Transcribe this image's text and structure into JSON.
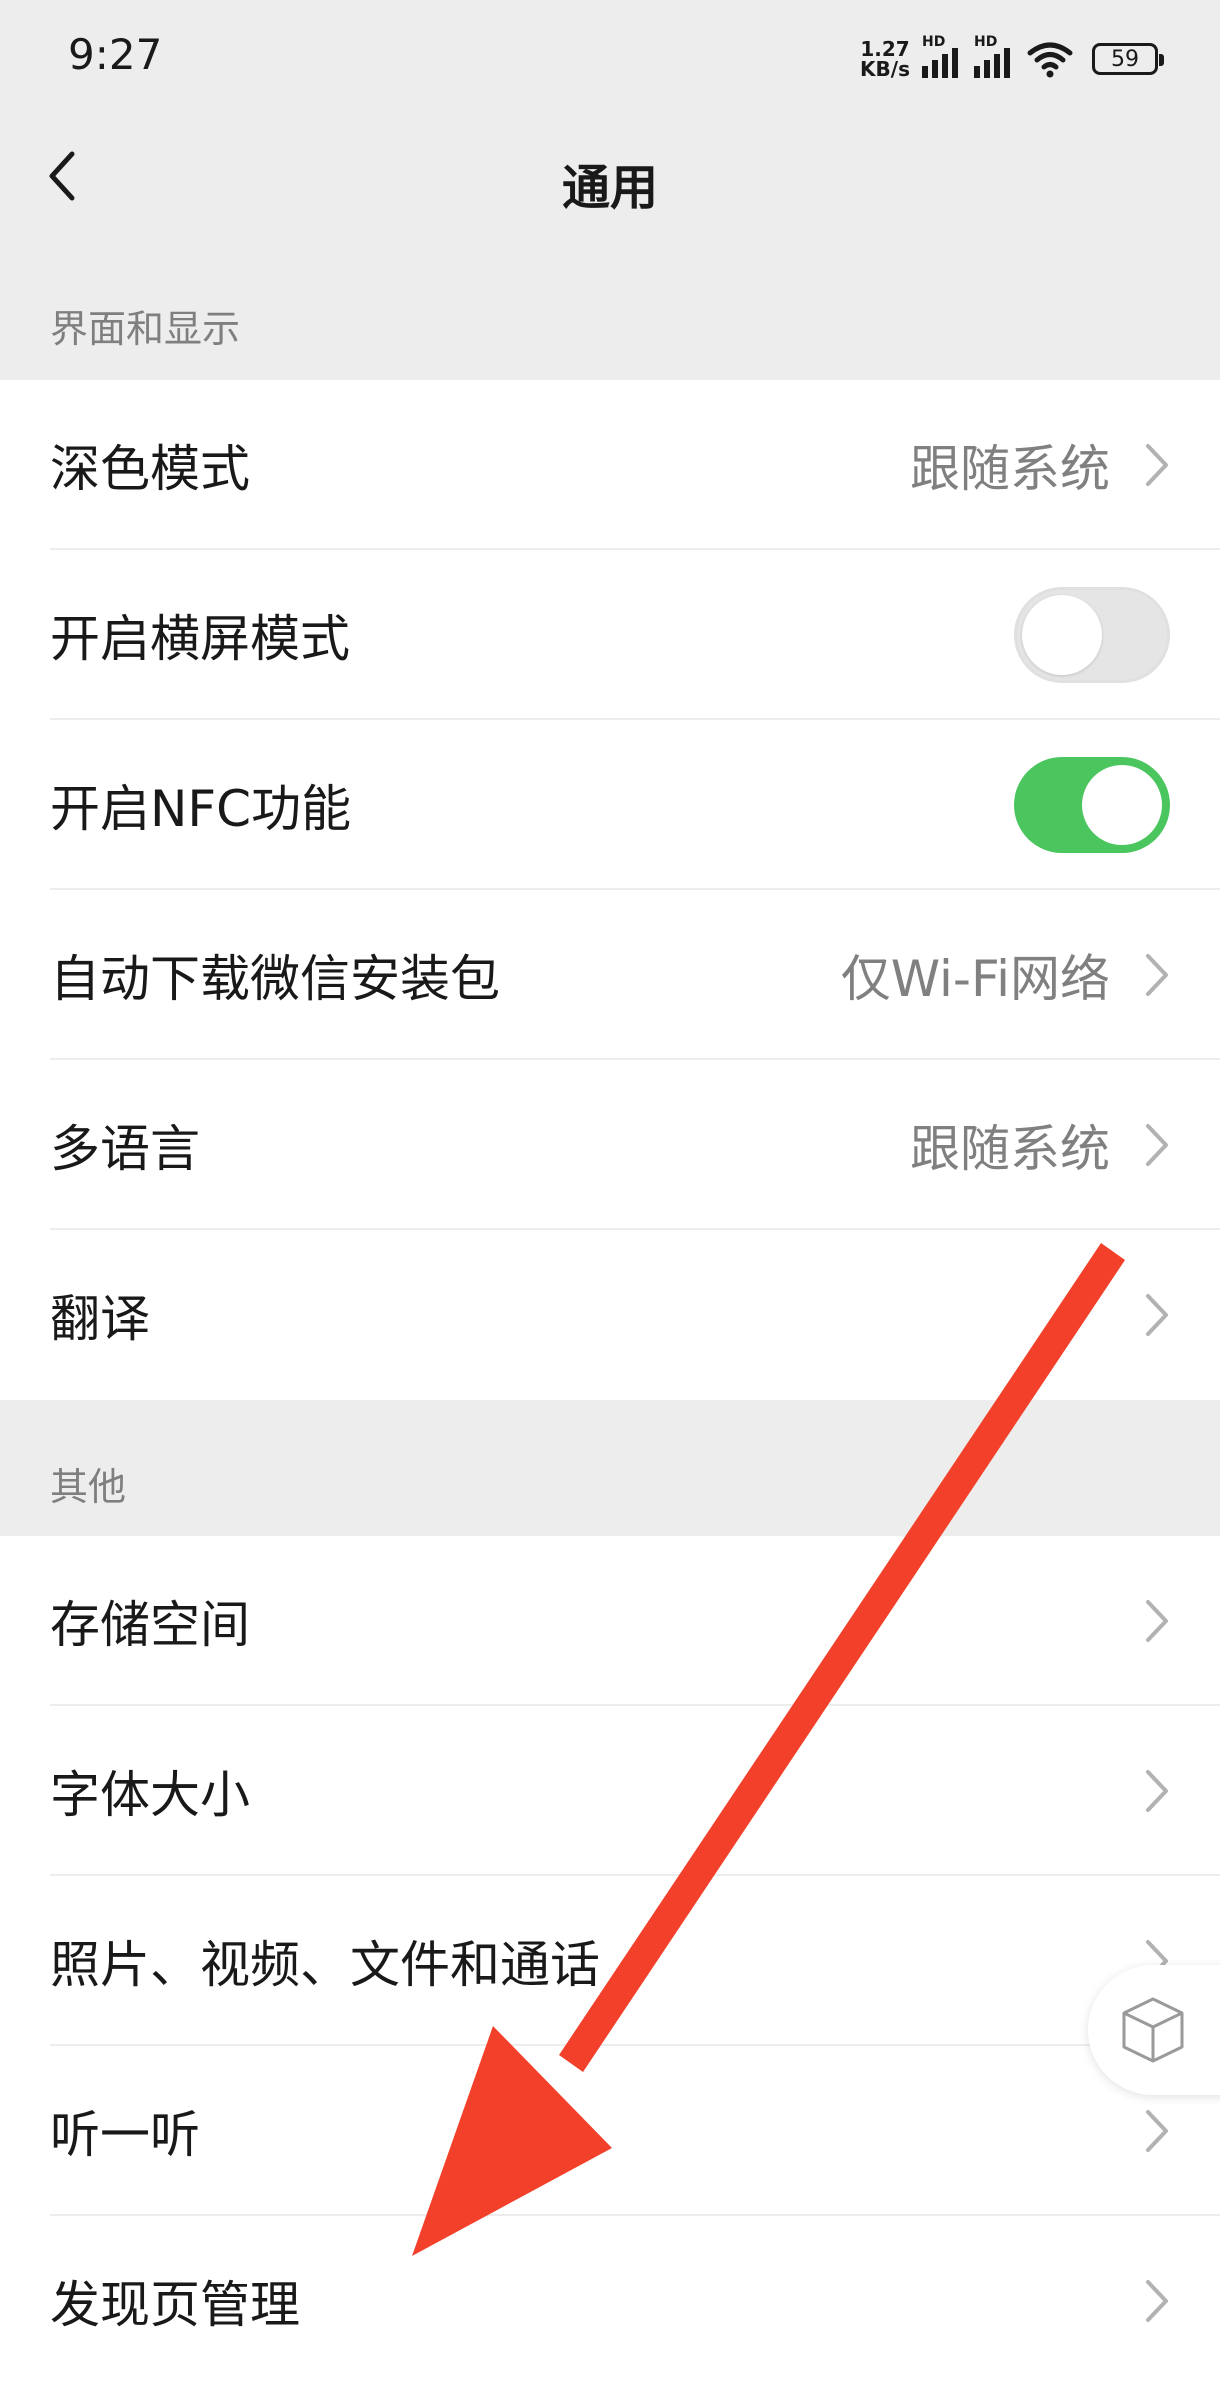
{
  "status_bar": {
    "time": "9:27",
    "net_speed_value": "1.27",
    "net_speed_unit": "KB/s",
    "sim1_label": "HD",
    "sim2_label": "HD",
    "battery": "59"
  },
  "nav": {
    "title": "通用"
  },
  "sections": {
    "display": {
      "header": "界面和显示",
      "rows": {
        "dark_mode": {
          "label": "深色模式",
          "value": "跟随系统"
        },
        "landscape": {
          "label": "开启横屏模式",
          "enabled": false
        },
        "nfc": {
          "label": "开启NFC功能",
          "enabled": true
        },
        "auto_download": {
          "label": "自动下载微信安装包",
          "value": "仅Wi-Fi网络"
        },
        "language": {
          "label": "多语言",
          "value": "跟随系统"
        },
        "translate": {
          "label": "翻译"
        }
      }
    },
    "other": {
      "header": "其他",
      "rows": {
        "storage": {
          "label": "存储空间"
        },
        "font_size": {
          "label": "字体大小"
        },
        "media": {
          "label": "照片、视频、文件和通话"
        },
        "listen": {
          "label": "听一听"
        },
        "discover": {
          "label": "发现页管理"
        }
      }
    }
  },
  "colors": {
    "toggle_on": "#4bc55e",
    "annotation_arrow": "#f2402a"
  },
  "icons": {
    "back": "chevron-left-icon",
    "row_arrow": "chevron-right-icon",
    "float": "cube-icon"
  }
}
